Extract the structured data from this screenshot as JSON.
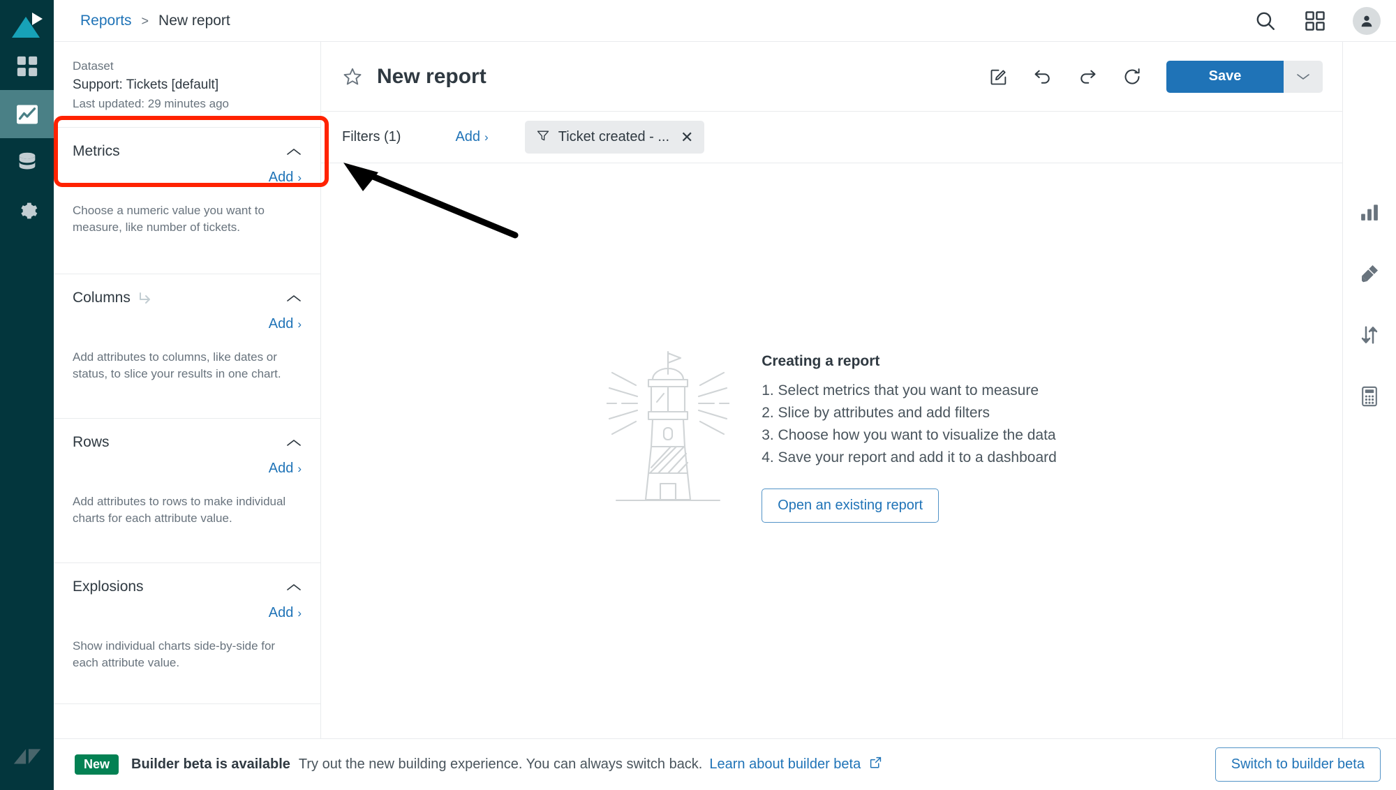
{
  "app": {
    "brand": "zendesk",
    "accent_blue": "#1f73b7",
    "rail_bg": "#03363d",
    "rail_active_bg": "#4a8086",
    "annotation_color": "#ff2200"
  },
  "rail": {
    "items": [
      {
        "name": "products-logo",
        "icon": "zendesk-play-icon"
      },
      {
        "name": "dashboards",
        "icon": "grid-squares-icon",
        "active": false
      },
      {
        "name": "reports",
        "icon": "chart-line-icon",
        "active": true
      },
      {
        "name": "datasets",
        "icon": "database-icon",
        "active": false
      },
      {
        "name": "settings",
        "icon": "gear-icon",
        "active": false
      }
    ],
    "footer_icon": "zendesk-logo-icon"
  },
  "topbar": {
    "breadcrumb": {
      "parent": "Reports",
      "separator": ">",
      "current": "New report"
    },
    "icons": [
      {
        "name": "search-icon",
        "label": "Search"
      },
      {
        "name": "products-grid-icon",
        "label": "Products"
      },
      {
        "name": "avatar",
        "label": "Account"
      }
    ]
  },
  "panel": {
    "dataset": {
      "label": "Dataset",
      "name": "Support: Tickets [default]",
      "updated": "Last updated: 29 minutes ago"
    },
    "sections": [
      {
        "key": "metrics",
        "title": "Metrics",
        "add_label": "Add",
        "add_chevron": "›",
        "collapse_icon": "chevron-up-icon",
        "hint": "Choose a numeric value you want to measure, like number of tickets.",
        "has_title_icon": false,
        "highlighted": true
      },
      {
        "key": "columns",
        "title": "Columns",
        "add_label": "Add",
        "add_chevron": "›",
        "collapse_icon": "chevron-up-icon",
        "hint": "Add attributes to columns, like dates or status, to slice your results in one chart.",
        "has_title_icon": true,
        "title_icon": "swap-arrow-icon",
        "highlighted": false
      },
      {
        "key": "rows",
        "title": "Rows",
        "add_label": "Add",
        "add_chevron": "›",
        "collapse_icon": "chevron-up-icon",
        "hint": "Add attributes to rows to make individual charts for each attribute value.",
        "has_title_icon": false,
        "highlighted": false
      },
      {
        "key": "explosions",
        "title": "Explosions",
        "add_label": "Add",
        "add_chevron": "›",
        "collapse_icon": "chevron-up-icon",
        "hint": "Show individual charts side-by-side for each attribute value.",
        "has_title_icon": false,
        "highlighted": false
      }
    ]
  },
  "report": {
    "title": "New report",
    "star_icon": "star-outline-icon",
    "tools": [
      {
        "name": "rename-icon",
        "label": "Rename"
      },
      {
        "name": "undo-icon",
        "label": "Undo"
      },
      {
        "name": "redo-icon",
        "label": "Redo"
      },
      {
        "name": "refresh-icon",
        "label": "Refresh"
      }
    ],
    "save_label": "Save",
    "save_caret_icon": "chevron-down-icon"
  },
  "filters": {
    "label": "Filters (1)",
    "add_label": "Add",
    "add_chevron": "›",
    "chips": [
      {
        "icon": "filter-funnel-icon",
        "text": "Ticket created - ...",
        "remove": "✕"
      }
    ]
  },
  "empty_state": {
    "illustration": "lighthouse-illustration",
    "title": "Creating a report",
    "steps": [
      "1. Select metrics that you want to measure",
      "2. Slice by attributes and add filters",
      "3. Choose how you want to visualize the data",
      "4. Save your report and add it to a dashboard"
    ],
    "button_label": "Open an existing report"
  },
  "right_rail": {
    "items": [
      {
        "name": "chart-type-icon",
        "label": "Chart type"
      },
      {
        "name": "chart-style-brush-icon",
        "label": "Chart configuration"
      },
      {
        "name": "sort-arrows-icon",
        "label": "Manipulate data"
      },
      {
        "name": "calculations-icon",
        "label": "Calculations"
      }
    ]
  },
  "banner": {
    "badge": "New",
    "headline": "Builder beta is available",
    "text": "Try out the new building experience. You can always switch back.",
    "link_label": "Learn about builder beta",
    "link_icon": "external-link-icon",
    "switch_label": "Switch to builder beta"
  }
}
